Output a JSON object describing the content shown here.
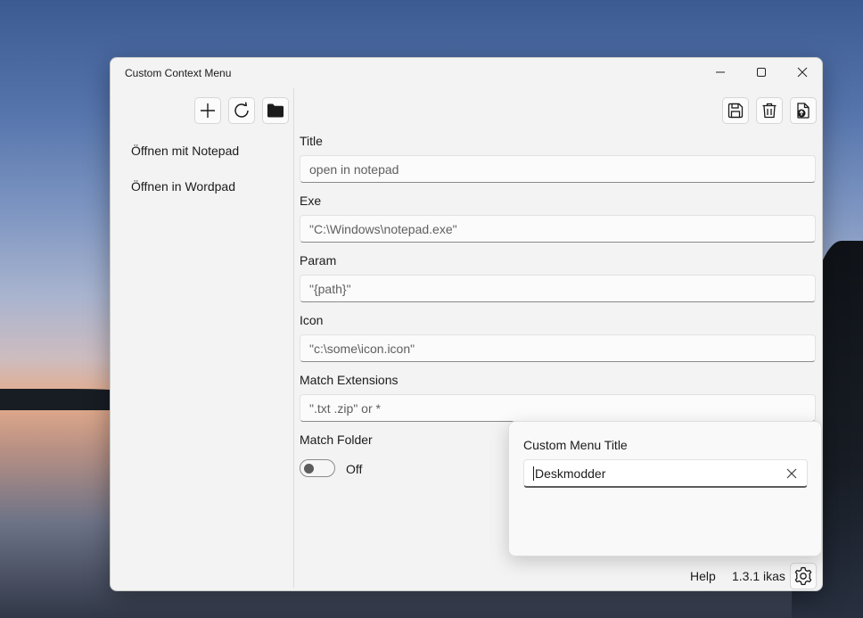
{
  "window": {
    "title": "Custom Context Menu"
  },
  "sidebar": {
    "items": [
      {
        "label": "Öffnen mit Notepad"
      },
      {
        "label": "Öffnen in Wordpad"
      }
    ]
  },
  "form": {
    "title_label": "Title",
    "title_placeholder": "open in notepad",
    "exe_label": "Exe",
    "exe_placeholder": "\"C:\\Windows\\notepad.exe\"",
    "param_label": "Param",
    "param_placeholder": "\"{path}\"",
    "icon_label": "Icon",
    "icon_placeholder": "\"c:\\some\\icon.icon\"",
    "ext_label": "Match Extensions",
    "ext_placeholder": "\".txt .zip\" or *",
    "folder_label": "Match Folder",
    "folder_state": "Off"
  },
  "footer": {
    "help": "Help",
    "version": "1.3.1 ikas"
  },
  "flyout": {
    "label": "Custom Menu Title",
    "value": "Deskmodder"
  },
  "icons": [
    "add-icon",
    "refresh-icon",
    "folder-icon",
    "save-icon",
    "delete-icon",
    "export-icon",
    "settings-icon",
    "clear-icon",
    "minimize-icon",
    "maximize-icon",
    "close-icon"
  ]
}
